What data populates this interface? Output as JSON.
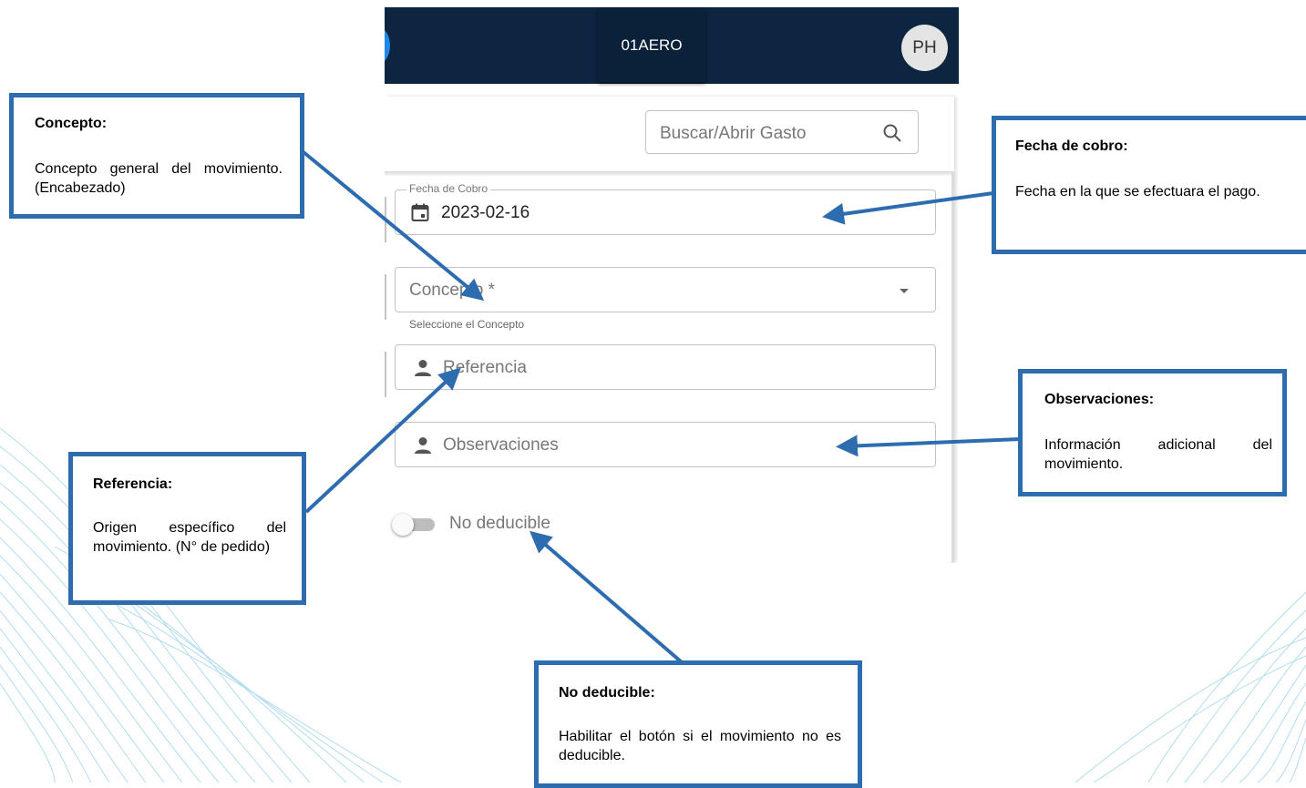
{
  "app": {
    "company_name": "01AERO",
    "avatar_initials": "PH",
    "search": {
      "placeholder": "Buscar/Abrir Gasto"
    },
    "form": {
      "fecha_cobro": {
        "label": "Fecha de Cobro",
        "value": "2023-02-16"
      },
      "concepto": {
        "placeholder": "Concepto *",
        "helper": "Seleccione el Concepto"
      },
      "referencia": {
        "placeholder": "Referencia"
      },
      "observaciones": {
        "placeholder": "Observaciones"
      },
      "no_deducible": {
        "label": "No deducible",
        "checked": false
      }
    }
  },
  "annotations": {
    "concepto": {
      "title": "Concepto:",
      "body": "Concepto general del movimiento. (Encabezado)"
    },
    "fecha_cobro": {
      "title": "Fecha de cobro:",
      "body": "Fecha en la que se efectuara el pago."
    },
    "observaciones": {
      "title": "Observaciones:",
      "body": "Información adicional del movimiento."
    },
    "referencia": {
      "title": "Referencia:",
      "body": "Origen específico del movimiento. (N° de pedido)"
    },
    "no_deducible": {
      "title": "No deducible:",
      "body": "Habilitar el botón si el movimiento no es deducible."
    }
  },
  "colors": {
    "topbar": "#0d2541",
    "callout_border": "#2e6cb0",
    "waves": "#9ed4ec"
  },
  "icons": [
    "search-icon",
    "calendar-icon",
    "dropdown-arrow-icon",
    "person-icon"
  ]
}
